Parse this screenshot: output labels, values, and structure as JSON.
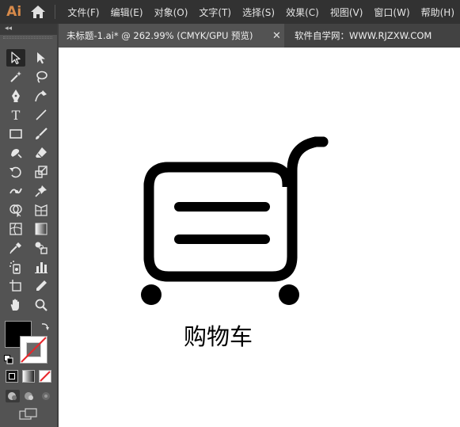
{
  "app": {
    "logo": "Ai"
  },
  "menu": {
    "items": [
      "文件(F)",
      "编辑(E)",
      "对象(O)",
      "文字(T)",
      "选择(S)",
      "效果(C)",
      "视图(V)",
      "窗口(W)",
      "帮助(H)"
    ]
  },
  "tabs": {
    "document": "未标题-1.ai* @ 262.99% (CMYK/GPU 预览)",
    "close": "✕",
    "site": "软件自学网：WWW.RJZXW.COM"
  },
  "toolbar": {
    "collapse": "◂◂",
    "type_tool": "T",
    "fill_color": "#000000",
    "stroke_color": "none"
  },
  "artwork": {
    "label": "购物车",
    "icon": "shopping-cart-icon"
  }
}
